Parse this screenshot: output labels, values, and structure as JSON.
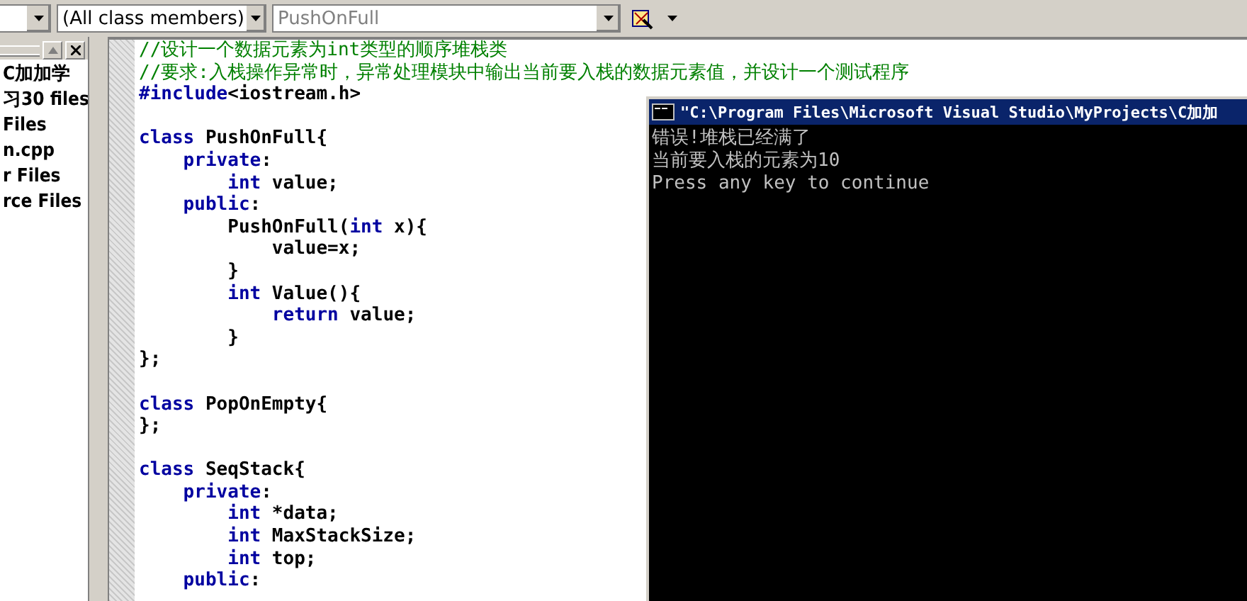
{
  "toolbar": {
    "class_combo": {
      "value": "(All class members)"
    },
    "member_combo": {
      "value": "PushOnFull",
      "disabled": true
    }
  },
  "workspace": {
    "items": [
      {
        "label": "C加加学"
      },
      {
        "label": "习30 files"
      },
      {
        "label": "Files"
      },
      {
        "label": "n.cpp"
      },
      {
        "label": "r Files"
      },
      {
        "label": "rce Files"
      }
    ]
  },
  "editor": {
    "lines": [
      {
        "kind": "code",
        "segments": [
          {
            "kind": "comment",
            "text": "//设计一个数据元素为int类型的顺序堆栈类"
          }
        ]
      },
      {
        "kind": "code",
        "segments": [
          {
            "kind": "comment",
            "text": "//要求:入栈操作异常时，异常处理模块中输出当前要入栈的数据元素值，并设计一个测试程序"
          }
        ]
      },
      {
        "kind": "code",
        "segments": [
          {
            "kind": "keyword",
            "text": "#include"
          },
          {
            "kind": "plain",
            "text": "<iostream.h>"
          }
        ]
      },
      {
        "kind": "blank"
      },
      {
        "kind": "code",
        "segments": [
          {
            "kind": "keyword",
            "text": "class"
          },
          {
            "kind": "plain",
            "text": " PushOnFull{"
          }
        ]
      },
      {
        "kind": "code",
        "segments": [
          {
            "kind": "keyword",
            "text": "    private"
          },
          {
            "kind": "plain",
            "text": ":"
          }
        ]
      },
      {
        "kind": "code",
        "segments": [
          {
            "kind": "keyword",
            "text": "        int"
          },
          {
            "kind": "plain",
            "text": " value;"
          }
        ]
      },
      {
        "kind": "code",
        "segments": [
          {
            "kind": "keyword",
            "text": "    public"
          },
          {
            "kind": "plain",
            "text": ":"
          }
        ]
      },
      {
        "kind": "code",
        "segments": [
          {
            "kind": "plain",
            "text": "        PushOnFull("
          },
          {
            "kind": "keyword",
            "text": "int"
          },
          {
            "kind": "plain",
            "text": " x){"
          }
        ]
      },
      {
        "kind": "code",
        "segments": [
          {
            "kind": "plain",
            "text": "            value=x;"
          }
        ]
      },
      {
        "kind": "code",
        "segments": [
          {
            "kind": "plain",
            "text": "        }"
          }
        ]
      },
      {
        "kind": "code",
        "segments": [
          {
            "kind": "keyword",
            "text": "        int"
          },
          {
            "kind": "plain",
            "text": " Value(){"
          }
        ]
      },
      {
        "kind": "code",
        "segments": [
          {
            "kind": "keyword",
            "text": "            return"
          },
          {
            "kind": "plain",
            "text": " value;"
          }
        ]
      },
      {
        "kind": "code",
        "segments": [
          {
            "kind": "plain",
            "text": "        }"
          }
        ]
      },
      {
        "kind": "code",
        "segments": [
          {
            "kind": "plain",
            "text": "};"
          }
        ]
      },
      {
        "kind": "blank"
      },
      {
        "kind": "code",
        "segments": [
          {
            "kind": "keyword",
            "text": "class"
          },
          {
            "kind": "plain",
            "text": " PopOnEmpty{"
          }
        ]
      },
      {
        "kind": "code",
        "segments": [
          {
            "kind": "plain",
            "text": "};"
          }
        ]
      },
      {
        "kind": "blank"
      },
      {
        "kind": "code",
        "segments": [
          {
            "kind": "keyword",
            "text": "class"
          },
          {
            "kind": "plain",
            "text": " SeqStack{"
          }
        ]
      },
      {
        "kind": "code",
        "segments": [
          {
            "kind": "keyword",
            "text": "    private"
          },
          {
            "kind": "plain",
            "text": ":"
          }
        ]
      },
      {
        "kind": "code",
        "segments": [
          {
            "kind": "keyword",
            "text": "        int"
          },
          {
            "kind": "plain",
            "text": " *data;"
          }
        ]
      },
      {
        "kind": "code",
        "segments": [
          {
            "kind": "keyword",
            "text": "        int"
          },
          {
            "kind": "plain",
            "text": " MaxStackSize;"
          }
        ]
      },
      {
        "kind": "code",
        "segments": [
          {
            "kind": "keyword",
            "text": "        int"
          },
          {
            "kind": "plain",
            "text": " top;"
          }
        ]
      },
      {
        "kind": "code",
        "segments": [
          {
            "kind": "keyword",
            "text": "    public"
          },
          {
            "kind": "plain",
            "text": ":"
          }
        ]
      }
    ]
  },
  "console": {
    "title": "\"C:\\Program Files\\Microsoft Visual Studio\\MyProjects\\C加加",
    "lines": [
      "错误!堆栈已经满了",
      "当前要入栈的元素为10",
      "Press any key to continue"
    ]
  }
}
